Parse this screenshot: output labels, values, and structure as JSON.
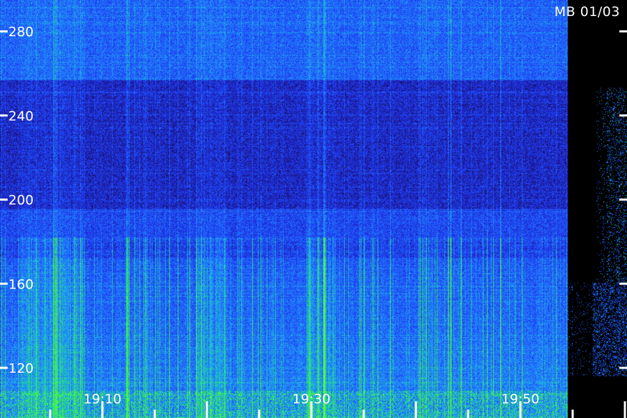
{
  "title": "MB 01/03",
  "chart_data": {
    "type": "heatmap",
    "title": "MB 01/03",
    "xlabel": "",
    "ylabel": "",
    "y_ticks": [
      280,
      240,
      200,
      160,
      120
    ],
    "ylim": [
      110,
      292
    ],
    "x_ticks": [
      "19:10",
      "19:30",
      "19:50"
    ],
    "x_tick_minutes": [
      70,
      90,
      110
    ],
    "xlim_minutes": [
      62,
      121
    ],
    "data_end_minute": 114.5,
    "colormap": [
      "#000000",
      "#1a0f66",
      "#1f2ee6",
      "#1f66ff",
      "#22aaf0",
      "#1fe07a",
      "#55ff33"
    ],
    "colors": {
      "background": "#000000",
      "text": "#ffffff"
    }
  }
}
